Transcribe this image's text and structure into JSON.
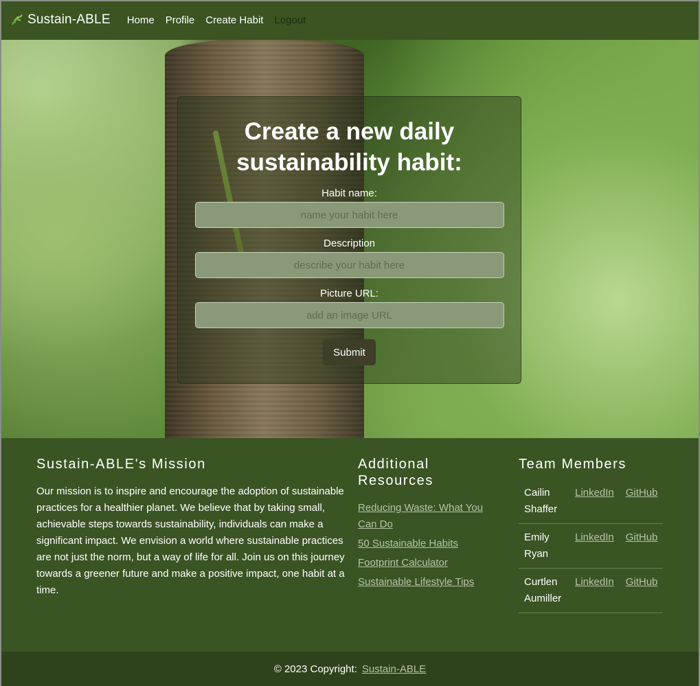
{
  "nav": {
    "brand": "Sustain-ABLE",
    "links": [
      "Home",
      "Profile",
      "Create Habit",
      "Logout"
    ]
  },
  "form": {
    "title": "Create a new daily sustainability habit:",
    "fields": [
      {
        "label": "Habit name:",
        "placeholder": "name your habit here"
      },
      {
        "label": "Description",
        "placeholder": "describe your habit here"
      },
      {
        "label": "Picture URL:",
        "placeholder": "add an image URL"
      }
    ],
    "submit_label": "Submit"
  },
  "footer": {
    "mission": {
      "heading": "Sustain-ABLE's Mission",
      "text": "Our mission is to inspire and encourage the adoption of sustainable practices for a healthier planet. We believe that by taking small, achievable steps towards sustainability, individuals can make a significant impact. We envision a world where sustainable practices are not just the norm, but a way of life for all. Join us on this journey towards a greener future and make a positive impact, one habit at a time."
    },
    "resources": {
      "heading": "Additional Resources",
      "links": [
        "Reducing Waste: What You Can Do",
        "50 Sustainable Habits",
        "Footprint Calculator",
        "Sustainable Lifestyle Tips"
      ]
    },
    "team": {
      "heading": "Team Members",
      "members": [
        {
          "name": "Cailin Shaffer",
          "linkedin": "LinkedIn",
          "github": "GitHub"
        },
        {
          "name": "Emily Ryan",
          "linkedin": "LinkedIn",
          "github": "GitHub"
        },
        {
          "name": "Curtlen Aumiller",
          "linkedin": "LinkedIn",
          "github": "GitHub"
        }
      ]
    },
    "copyright": {
      "text": "© 2023 Copyright:",
      "link": "Sustain-ABLE"
    }
  },
  "colors": {
    "primary": "#3a5424",
    "nav": "#3b5422",
    "footer_bottom": "#2e431b",
    "button": "#3e3e29",
    "link": "#b7c3a8"
  },
  "icons": {
    "brand": "leaf-icon"
  }
}
